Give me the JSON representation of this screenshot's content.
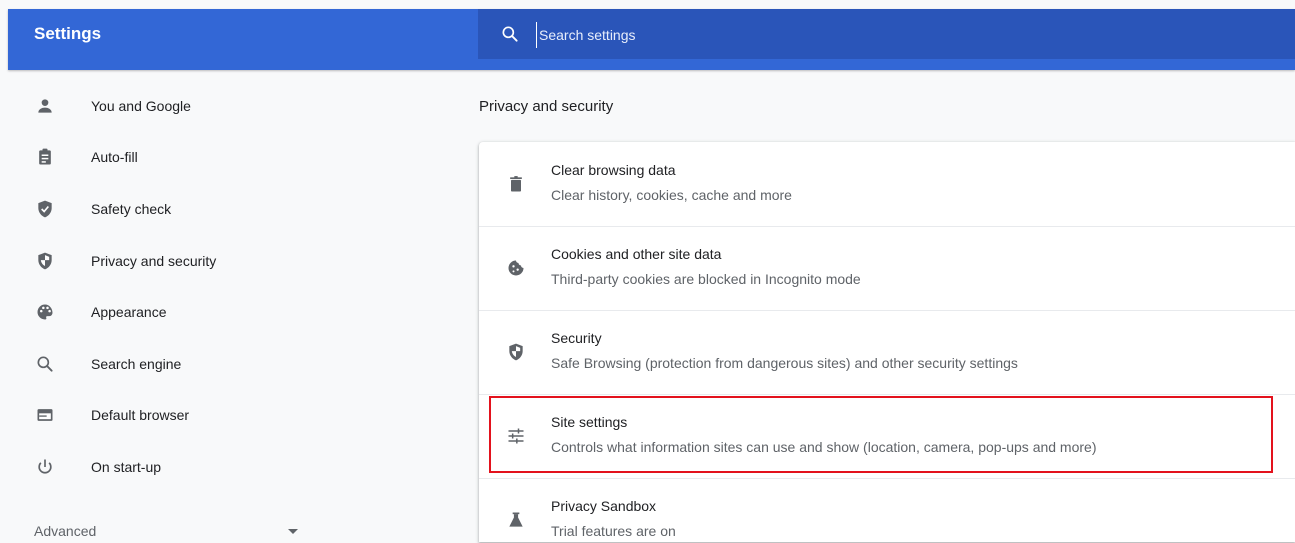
{
  "header": {
    "title": "Settings",
    "search_placeholder": "Search settings"
  },
  "sidebar": {
    "items": [
      {
        "label": "You and Google",
        "icon": "person-icon"
      },
      {
        "label": "Auto-fill",
        "icon": "clipboard-icon"
      },
      {
        "label": "Safety check",
        "icon": "shield-check-icon"
      },
      {
        "label": "Privacy and security",
        "icon": "shield-icon"
      },
      {
        "label": "Appearance",
        "icon": "palette-icon"
      },
      {
        "label": "Search engine",
        "icon": "search-icon"
      },
      {
        "label": "Default browser",
        "icon": "browser-icon"
      },
      {
        "label": "On start-up",
        "icon": "power-icon"
      }
    ],
    "advanced_label": "Advanced"
  },
  "main": {
    "section_title": "Privacy and security",
    "rows": [
      {
        "title": "Clear browsing data",
        "subtitle": "Clear history, cookies, cache and more",
        "icon": "trash-icon"
      },
      {
        "title": "Cookies and other site data",
        "subtitle": "Third-party cookies are blocked in Incognito mode",
        "icon": "cookie-icon"
      },
      {
        "title": "Security",
        "subtitle": "Safe Browsing (protection from dangerous sites) and other security settings",
        "icon": "shield-icon"
      },
      {
        "title": "Site settings",
        "subtitle": "Controls what information sites can use and show (location, camera, pop-ups and more)",
        "icon": "tune-icon",
        "highlighted": true
      },
      {
        "title": "Privacy Sandbox",
        "subtitle": "Trial features are on",
        "icon": "flask-icon"
      }
    ]
  },
  "colors": {
    "header_bg": "#3367d6",
    "search_bg": "#2a55b9",
    "highlight_border": "#e3121d"
  }
}
